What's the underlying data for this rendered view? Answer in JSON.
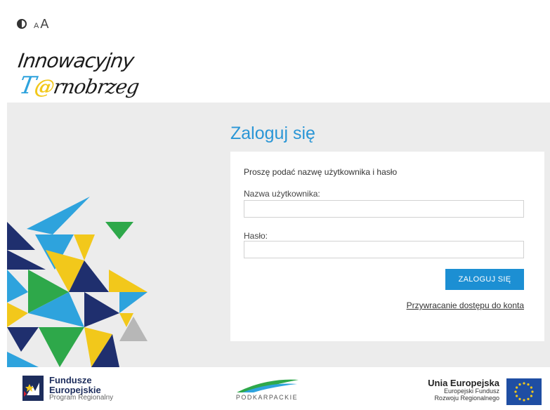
{
  "accessibility": {
    "font_small": "A",
    "font_large": "A"
  },
  "logo": {
    "line1": "Innowacyjny",
    "line2_t": "T",
    "line2_at": "@",
    "line2_rest": "rnobrzeg"
  },
  "login": {
    "title": "Zaloguj się",
    "instruction": "Proszę podać nazwę użytkownika i hasło",
    "username_label": "Nazwa użytkownika:",
    "username_value": "",
    "password_label": "Hasło:",
    "password_value": "",
    "submit_label": "ZALOGUJ SIĘ",
    "recovery_link": "Przywracanie dostępu do konta"
  },
  "footer": {
    "fe_line1": "Fundusze",
    "fe_line2": "Europejskie",
    "fe_line3": "Program Regionalny",
    "podkarpackie": "PODKARPACKIE",
    "eu_title": "Unia Europejska",
    "eu_line1": "Europejski Fundusz",
    "eu_line2": "Rozwoju Regionalnego"
  },
  "colors": {
    "accent_blue": "#2a96d6",
    "button_blue": "#1c8fd3",
    "triangle_yellow": "#f2c81b",
    "triangle_green": "#2ea84a",
    "triangle_navy": "#1f2f6e",
    "triangle_light_blue": "#2ea3dd",
    "triangle_grey": "#b7b7b7"
  }
}
